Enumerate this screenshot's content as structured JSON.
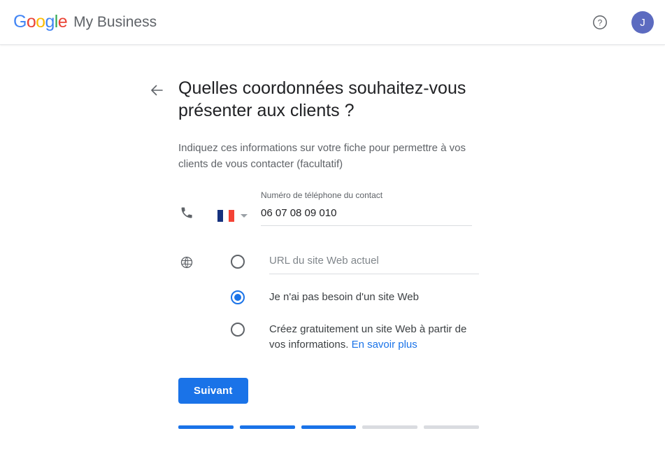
{
  "header": {
    "logo_parts": [
      {
        "letter": "G",
        "color": "#4285f4"
      },
      {
        "letter": "o",
        "color": "#ea4335"
      },
      {
        "letter": "o",
        "color": "#fbbc05"
      },
      {
        "letter": "g",
        "color": "#4285f4"
      },
      {
        "letter": "l",
        "color": "#34a853"
      },
      {
        "letter": "e",
        "color": "#ea4335"
      }
    ],
    "product_name": "My Business",
    "help_icon": "help-circle-icon",
    "avatar_initial": "J",
    "avatar_color": "#5c6bc0"
  },
  "main": {
    "back_icon": "arrow-left-icon",
    "title": "Quelles coordonnées souhaitez-vous présenter aux clients ?",
    "subtitle": "Indiquez ces informations sur votre fiche pour permettre à vos clients de vous contacter (facultatif)"
  },
  "phone": {
    "icon": "phone-icon",
    "country_flag": "france-flag-icon",
    "country_caret": "chevron-down-icon",
    "label": "Numéro de téléphone du contact",
    "value": "06 07 08 09 010"
  },
  "website": {
    "icon": "globe-icon",
    "options": [
      {
        "id": "existing-url",
        "selected": false,
        "placeholder": "URL du site Web actuel",
        "is_input": true
      },
      {
        "id": "no-website",
        "selected": true,
        "label": "Je n'ai pas besoin d'un site Web",
        "is_input": false
      },
      {
        "id": "free-website",
        "selected": false,
        "label": "Créez gratuitement un site Web à partir de vos informations.",
        "link_text": "En savoir plus",
        "is_input": false
      }
    ]
  },
  "footer": {
    "next_label": "Suivant",
    "progress": {
      "total": 5,
      "completed": 3,
      "active_color": "#1a73e8",
      "inactive_color": "#dadce0"
    }
  }
}
